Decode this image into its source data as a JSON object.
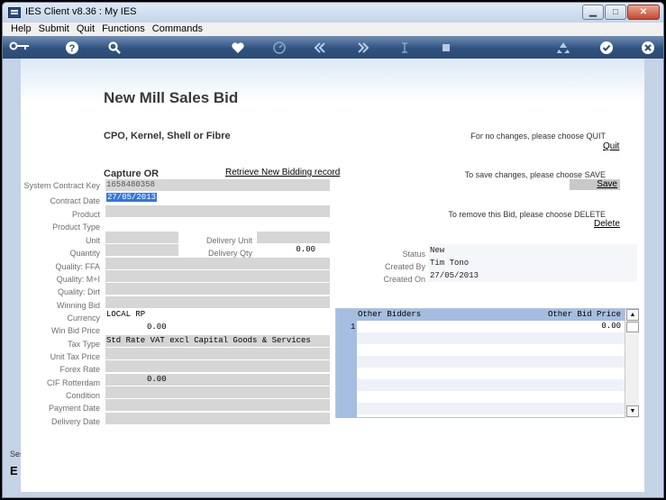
{
  "window": {
    "title": "IES Client v8.36 : My IES",
    "buttons": {
      "minimize": "▁",
      "maximize": "□",
      "close": "✕"
    }
  },
  "menu": [
    "Help",
    "Submit",
    "Quit",
    "Functions",
    "Commands"
  ],
  "toolbar": [
    "key-icon",
    "help-icon",
    "search-icon",
    "heart-icon",
    "clock-icon",
    "rewind-icon",
    "fast-forward-icon",
    "text-cursor-icon",
    "stop-icon",
    "recycle-icon",
    "check-icon",
    "close-icon"
  ],
  "side": {
    "ses": "Ses",
    "e": "E"
  },
  "page": {
    "title": "New Mill Sales Bid",
    "subtitle": "CPO, Kernel, Shell or Fibre",
    "section": "Capture OR",
    "retrieve_link": "Retrieve New Bidding record"
  },
  "actions": {
    "quit_msg": "For no changes, please choose QUIT",
    "quit_link": "Quit",
    "save_msg": "To save changes, please choose SAVE",
    "save_link": "Save",
    "delete_msg": "To remove this Bid,  please choose  DELETE",
    "delete_link": "Delete"
  },
  "form": {
    "system_contract_key": {
      "label": "System Contract Key",
      "value": "1658480358"
    },
    "contract_date": {
      "label": "Contract Date",
      "value": "27/05/2013"
    },
    "product": {
      "label": "Product",
      "value": ""
    },
    "product_type": {
      "label": "Product Type",
      "value": ""
    },
    "unit": {
      "label": "Unit",
      "value": ""
    },
    "delivery_unit": {
      "label": "Delivery Unit",
      "value": ""
    },
    "quantity": {
      "label": "Quantity",
      "value": ""
    },
    "delivery_qty": {
      "label": "Delivery Qty",
      "value": "0.00"
    },
    "quality_ffa": {
      "label": "Quality: FFA",
      "value": ""
    },
    "quality_mi": {
      "label": "Quality: M+I",
      "value": ""
    },
    "quality_dirt": {
      "label": "Quality: Dirt",
      "value": ""
    },
    "winning_bid": {
      "label": "Winning Bid",
      "value": ""
    },
    "currency": {
      "label": "Currency",
      "value": "LOCAL RP"
    },
    "win_bid_price": {
      "label": "Win Bid Price",
      "value": "0.00"
    },
    "tax_type": {
      "label": "Tax Type",
      "value": "Std Rate VAT excl Capital Goods & Services"
    },
    "unit_tax_price": {
      "label": "Unit Tax Price",
      "value": ""
    },
    "forex_rate": {
      "label": "Forex Rate",
      "value": ""
    },
    "cif_rotterdam": {
      "label": "CIF Rotterdam",
      "value": "0.00"
    },
    "condition": {
      "label": "Condition",
      "value": ""
    },
    "payment_date": {
      "label": "Payment Date",
      "value": ""
    },
    "delivery_date": {
      "label": "Delivery Date",
      "value": ""
    }
  },
  "info": {
    "status": {
      "label": "Status",
      "value": "New"
    },
    "created_by": {
      "label": "Created By",
      "value": "Tim Tono"
    },
    "created_on": {
      "label": "Created On",
      "value": "27/05/2013"
    }
  },
  "bidders_grid": {
    "columns": [
      "Other Bidders",
      "Other Bid Price"
    ],
    "rows": [
      {
        "num": "1",
        "bidder": "",
        "price": "0.00"
      }
    ],
    "scroll_up": "▲",
    "scroll_down": "▼"
  }
}
